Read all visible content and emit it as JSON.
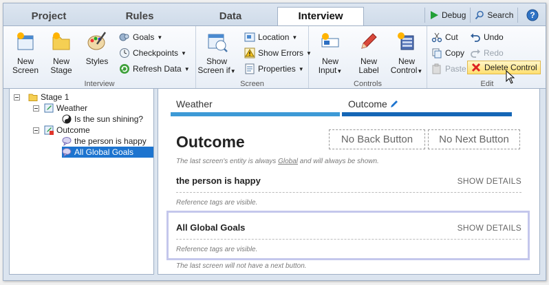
{
  "tabs": [
    "Project",
    "Rules",
    "Data",
    "Interview"
  ],
  "active_tab": "Interview",
  "tabbar_right": {
    "debug": "Debug",
    "search": "Search"
  },
  "ribbon": {
    "interview": {
      "label": "Interview",
      "new_screen": "New Screen",
      "new_stage": "New Stage",
      "styles": "Styles",
      "goals": "Goals",
      "checkpoints": "Checkpoints",
      "refresh_data": "Refresh Data"
    },
    "screen": {
      "label": "Screen",
      "show_screen_if": "Show Screen if",
      "location": "Location",
      "show_errors": "Show Errors",
      "properties": "Properties"
    },
    "controls": {
      "label": "Controls",
      "new_input": "New Input",
      "new_label": "New Label",
      "new_control": "New Control"
    },
    "edit": {
      "label": "Edit",
      "cut": "Cut",
      "copy": "Copy",
      "paste": "Paste",
      "undo": "Undo",
      "redo": "Redo",
      "delete_control": "Delete Control"
    }
  },
  "tree": [
    {
      "label": "Stage 1",
      "icon": "folder-icon"
    },
    {
      "label": "Weather",
      "icon": "screen-icon"
    },
    {
      "label": "Is the sun shining?",
      "icon": "yin-yang-icon"
    },
    {
      "label": "Outcome",
      "icon": "outcome-screen-icon"
    },
    {
      "label": "the person is happy",
      "icon": "goal-bubble-icon"
    },
    {
      "label": "All Global Goals",
      "icon": "goal-bubble-icon",
      "selected": true
    }
  ],
  "canvas": {
    "steps": [
      "Weather",
      "Outcome"
    ],
    "screen_title": "Outcome",
    "no_back": "No Back Button",
    "no_next": "No Next Button",
    "entity_note_pre": "The last screen's entity is always ",
    "entity_note_link": "Global",
    "entity_note_post": " and will always be shown.",
    "controls": [
      {
        "title": "the person is happy",
        "show": "SHOW DETAILS",
        "note": "Reference tags are visible."
      },
      {
        "title": "All Global Goals",
        "show": "SHOW DETAILS",
        "note": "Reference tags are visible."
      }
    ],
    "last_note": "The last screen will not have a next button."
  },
  "colors": {
    "accent": "#1d74cf",
    "progress_light": "#3d9ad6",
    "progress_dark": "#1566b6"
  }
}
